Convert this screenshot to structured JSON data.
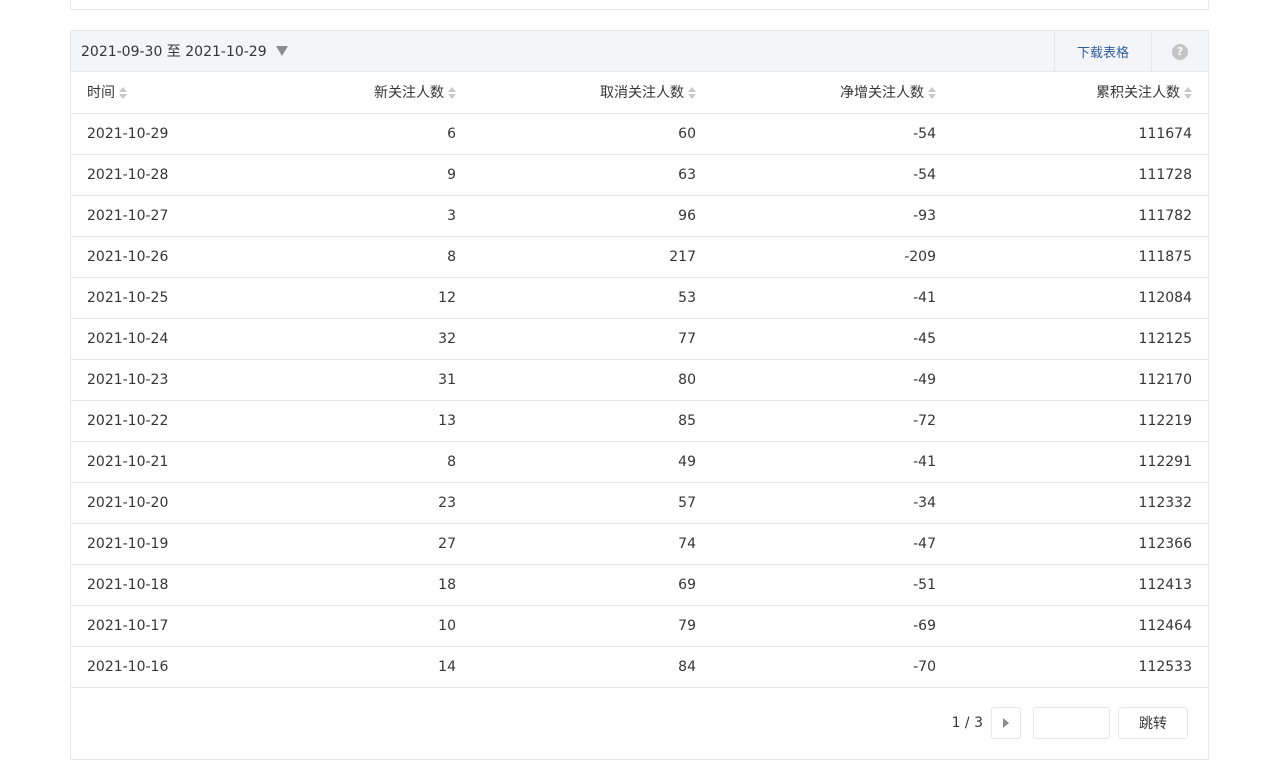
{
  "date_range": "2021-09-30 至 2021-10-29",
  "download_label": "下载表格",
  "help_icon": "?",
  "columns": [
    "时间",
    "新关注人数",
    "取消关注人数",
    "净增关注人数",
    "累积关注人数"
  ],
  "rows": [
    [
      "2021-10-29",
      "6",
      "60",
      "-54",
      "111674"
    ],
    [
      "2021-10-28",
      "9",
      "63",
      "-54",
      "111728"
    ],
    [
      "2021-10-27",
      "3",
      "96",
      "-93",
      "111782"
    ],
    [
      "2021-10-26",
      "8",
      "217",
      "-209",
      "111875"
    ],
    [
      "2021-10-25",
      "12",
      "53",
      "-41",
      "112084"
    ],
    [
      "2021-10-24",
      "32",
      "77",
      "-45",
      "112125"
    ],
    [
      "2021-10-23",
      "31",
      "80",
      "-49",
      "112170"
    ],
    [
      "2021-10-22",
      "13",
      "85",
      "-72",
      "112219"
    ],
    [
      "2021-10-21",
      "8",
      "49",
      "-41",
      "112291"
    ],
    [
      "2021-10-20",
      "23",
      "57",
      "-34",
      "112332"
    ],
    [
      "2021-10-19",
      "27",
      "74",
      "-47",
      "112366"
    ],
    [
      "2021-10-18",
      "18",
      "69",
      "-51",
      "112413"
    ],
    [
      "2021-10-17",
      "10",
      "79",
      "-69",
      "112464"
    ],
    [
      "2021-10-16",
      "14",
      "84",
      "-70",
      "112533"
    ]
  ],
  "pagination": {
    "page_info": "1 / 3",
    "jump_value": "",
    "jump_label": "跳转"
  }
}
